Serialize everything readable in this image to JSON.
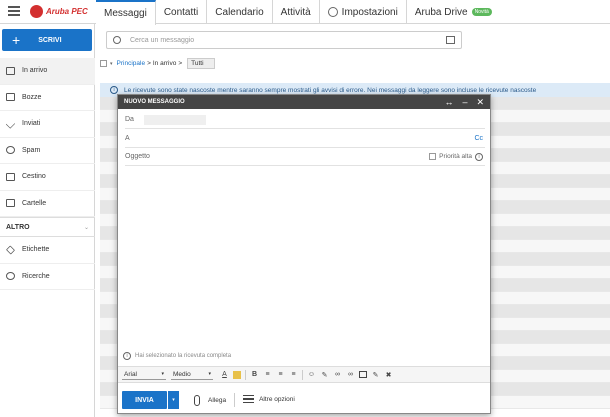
{
  "app": {
    "logo_text": "Aruba PEC"
  },
  "tabs": [
    {
      "label": "Messaggi"
    },
    {
      "label": "Contatti"
    },
    {
      "label": "Calendario"
    },
    {
      "label": "Attività"
    },
    {
      "label": "Impostazioni"
    },
    {
      "label": "Aruba Drive",
      "badge": "Novità"
    }
  ],
  "sidebar": {
    "compose_label": "SCRIVI",
    "items": [
      {
        "label": "In arrivo"
      },
      {
        "label": "Bozze"
      },
      {
        "label": "Inviati"
      },
      {
        "label": "Spam"
      },
      {
        "label": "Cestino"
      },
      {
        "label": "Cartelle"
      }
    ],
    "section_title": "ALTRO",
    "more_items": [
      {
        "label": "Etichette"
      },
      {
        "label": "Ricerche"
      }
    ]
  },
  "search": {
    "placeholder": "Cerca un messaggio"
  },
  "breadcrumb": {
    "items": [
      "Principale",
      "In arrivo"
    ],
    "filter": "Tutti"
  },
  "banner": {
    "text": "Le ricevute sono state nascoste mentre saranno sempre mostrati gli avvisi di errore. Nei messaggi da leggere sono incluse le ricevute nascoste"
  },
  "compose": {
    "title": "NUOVO MESSAGGIO",
    "controls": [
      "↔",
      "–",
      "✕"
    ],
    "from_label": "Da",
    "to_label": "A",
    "cc_label": "Cc",
    "subject_label": "Oggetto",
    "priority_label": "Priorità alta",
    "receipt_text": "Hai selezionato la ricevuta completa",
    "font_family": "Arial",
    "font_size": "Medio",
    "send_label": "INVIA",
    "attach_label": "Allega",
    "more_options_label": "Altre opzioni"
  }
}
